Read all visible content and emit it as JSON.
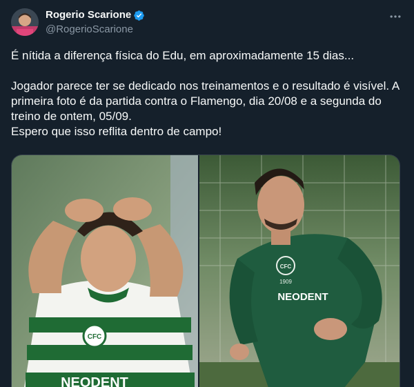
{
  "author": {
    "display_name": "Rogerio Scarione",
    "handle": "@RogerioScarione",
    "verified": true,
    "avatar_icon": "user-avatar"
  },
  "menu": {
    "icon": "more-horizontal-icon"
  },
  "tweet": {
    "lines": [
      "É nítida a diferença física do Edu, em aproximadamente 15 dias...",
      "",
      "Jogador parece ter se dedicado nos treinamentos e o resultado é visível. A primeira foto é da partida contra o Flamengo, dia 20/08 e a segunda do treino de ontem, 05/09.",
      "Espero que isso reflita dentro de campo!"
    ]
  },
  "media": {
    "photos": [
      {
        "shirt_text": "NEODENT",
        "shirt_logo_text": "CFC"
      },
      {
        "shirt_text": "NEODENT",
        "shirt_year": "1909",
        "shirt_logo_text": "CFC"
      }
    ]
  },
  "colors": {
    "background": "#15202b",
    "text": "#f7f9f9",
    "muted": "#8b98a5",
    "verified": "#1d9bf0"
  }
}
